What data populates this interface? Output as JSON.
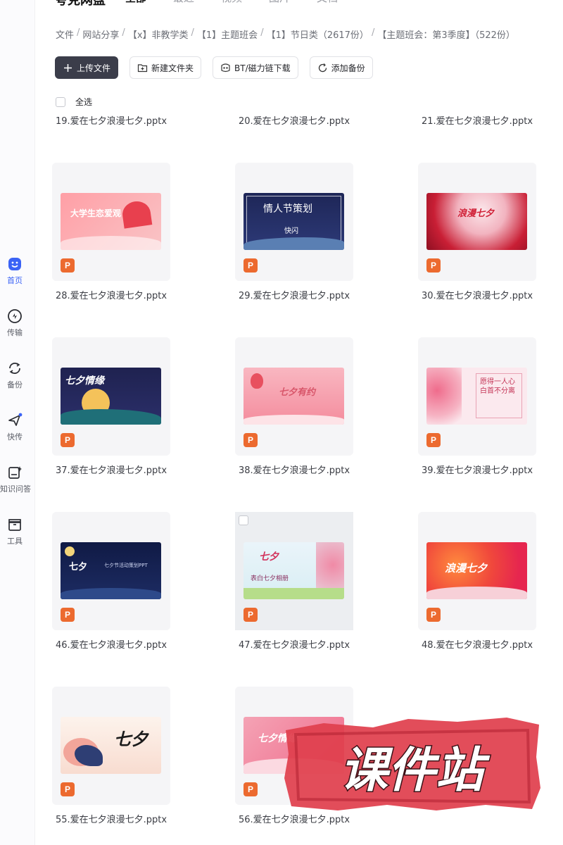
{
  "app": {
    "brand": "夸克网盘"
  },
  "top_tabs": [
    "全部",
    "最近",
    "视频",
    "图片",
    "文档"
  ],
  "sidebar": {
    "items": [
      {
        "label": "首页",
        "icon": "home-icon"
      },
      {
        "label": "传输",
        "icon": "transfer-icon"
      },
      {
        "label": "备份",
        "icon": "backup-icon"
      },
      {
        "label": "快传",
        "icon": "quick-send-icon"
      },
      {
        "label": "知识问答",
        "icon": "knowledge-qa-icon"
      },
      {
        "label": "工具",
        "icon": "tools-icon"
      }
    ]
  },
  "breadcrumb": [
    "文件",
    "网站分享",
    "【x】非教学类",
    "【1】主题班会",
    "【1】节日类（2617份）",
    "【主题班会：第3季度】（522份）"
  ],
  "toolbar": {
    "upload": "上传文件",
    "new_folder": "新建文件夹",
    "bt": "BT/磁力链下载",
    "backup": "添加备份"
  },
  "select_all": "全选",
  "top_files": [
    "19.爱在七夕浪漫七夕.pptx",
    "20.爱在七夕浪漫七夕.pptx",
    "21.爱在七夕浪漫七夕.pptx"
  ],
  "files": [
    {
      "name": "28.爱在七夕浪漫七夕.pptx",
      "thumb_title": "大学生恋爱观",
      "file_type": "P"
    },
    {
      "name": "29.爱在七夕浪漫七夕.pptx",
      "thumb_title": "情人节策划",
      "thumb_sub": "快闪",
      "file_type": "P"
    },
    {
      "name": "30.爱在七夕浪漫七夕.pptx",
      "thumb_title": "浪漫七夕",
      "file_type": "P"
    },
    {
      "name": "37.爱在七夕浪漫七夕.pptx",
      "thumb_title": "七夕情缘",
      "file_type": "P"
    },
    {
      "name": "38.爱在七夕浪漫七夕.pptx",
      "thumb_title": "七夕有约",
      "file_type": "P"
    },
    {
      "name": "39.爱在七夕浪漫七夕.pptx",
      "thumb_title": "愿得一人心 白首不分离",
      "file_type": "P"
    },
    {
      "name": "46.爱在七夕浪漫七夕.pptx",
      "thumb_title": "七夕",
      "thumb_sub": "七夕节活动策划PPT",
      "file_type": "P"
    },
    {
      "name": "47.爱在七夕浪漫七夕.pptx",
      "thumb_title": "七夕",
      "thumb_sub": "表白七夕相册",
      "file_type": "P"
    },
    {
      "name": "48.爱在七夕浪漫七夕.pptx",
      "thumb_title": "浪漫七夕",
      "file_type": "P"
    },
    {
      "name": "55.爱在七夕浪漫七夕.pptx",
      "thumb_title": "七夕",
      "file_type": "P"
    },
    {
      "name": "56.爱在七夕浪漫七夕.pptx",
      "thumb_title": "七夕情缘",
      "file_type": "P"
    }
  ],
  "watermark": {
    "text": "课件站"
  },
  "colors": {
    "accent": "#3b63f5",
    "ppt_icon": "#ec6a2f",
    "primary_button": "#3b3d4a",
    "watermark": "#e0404e"
  }
}
